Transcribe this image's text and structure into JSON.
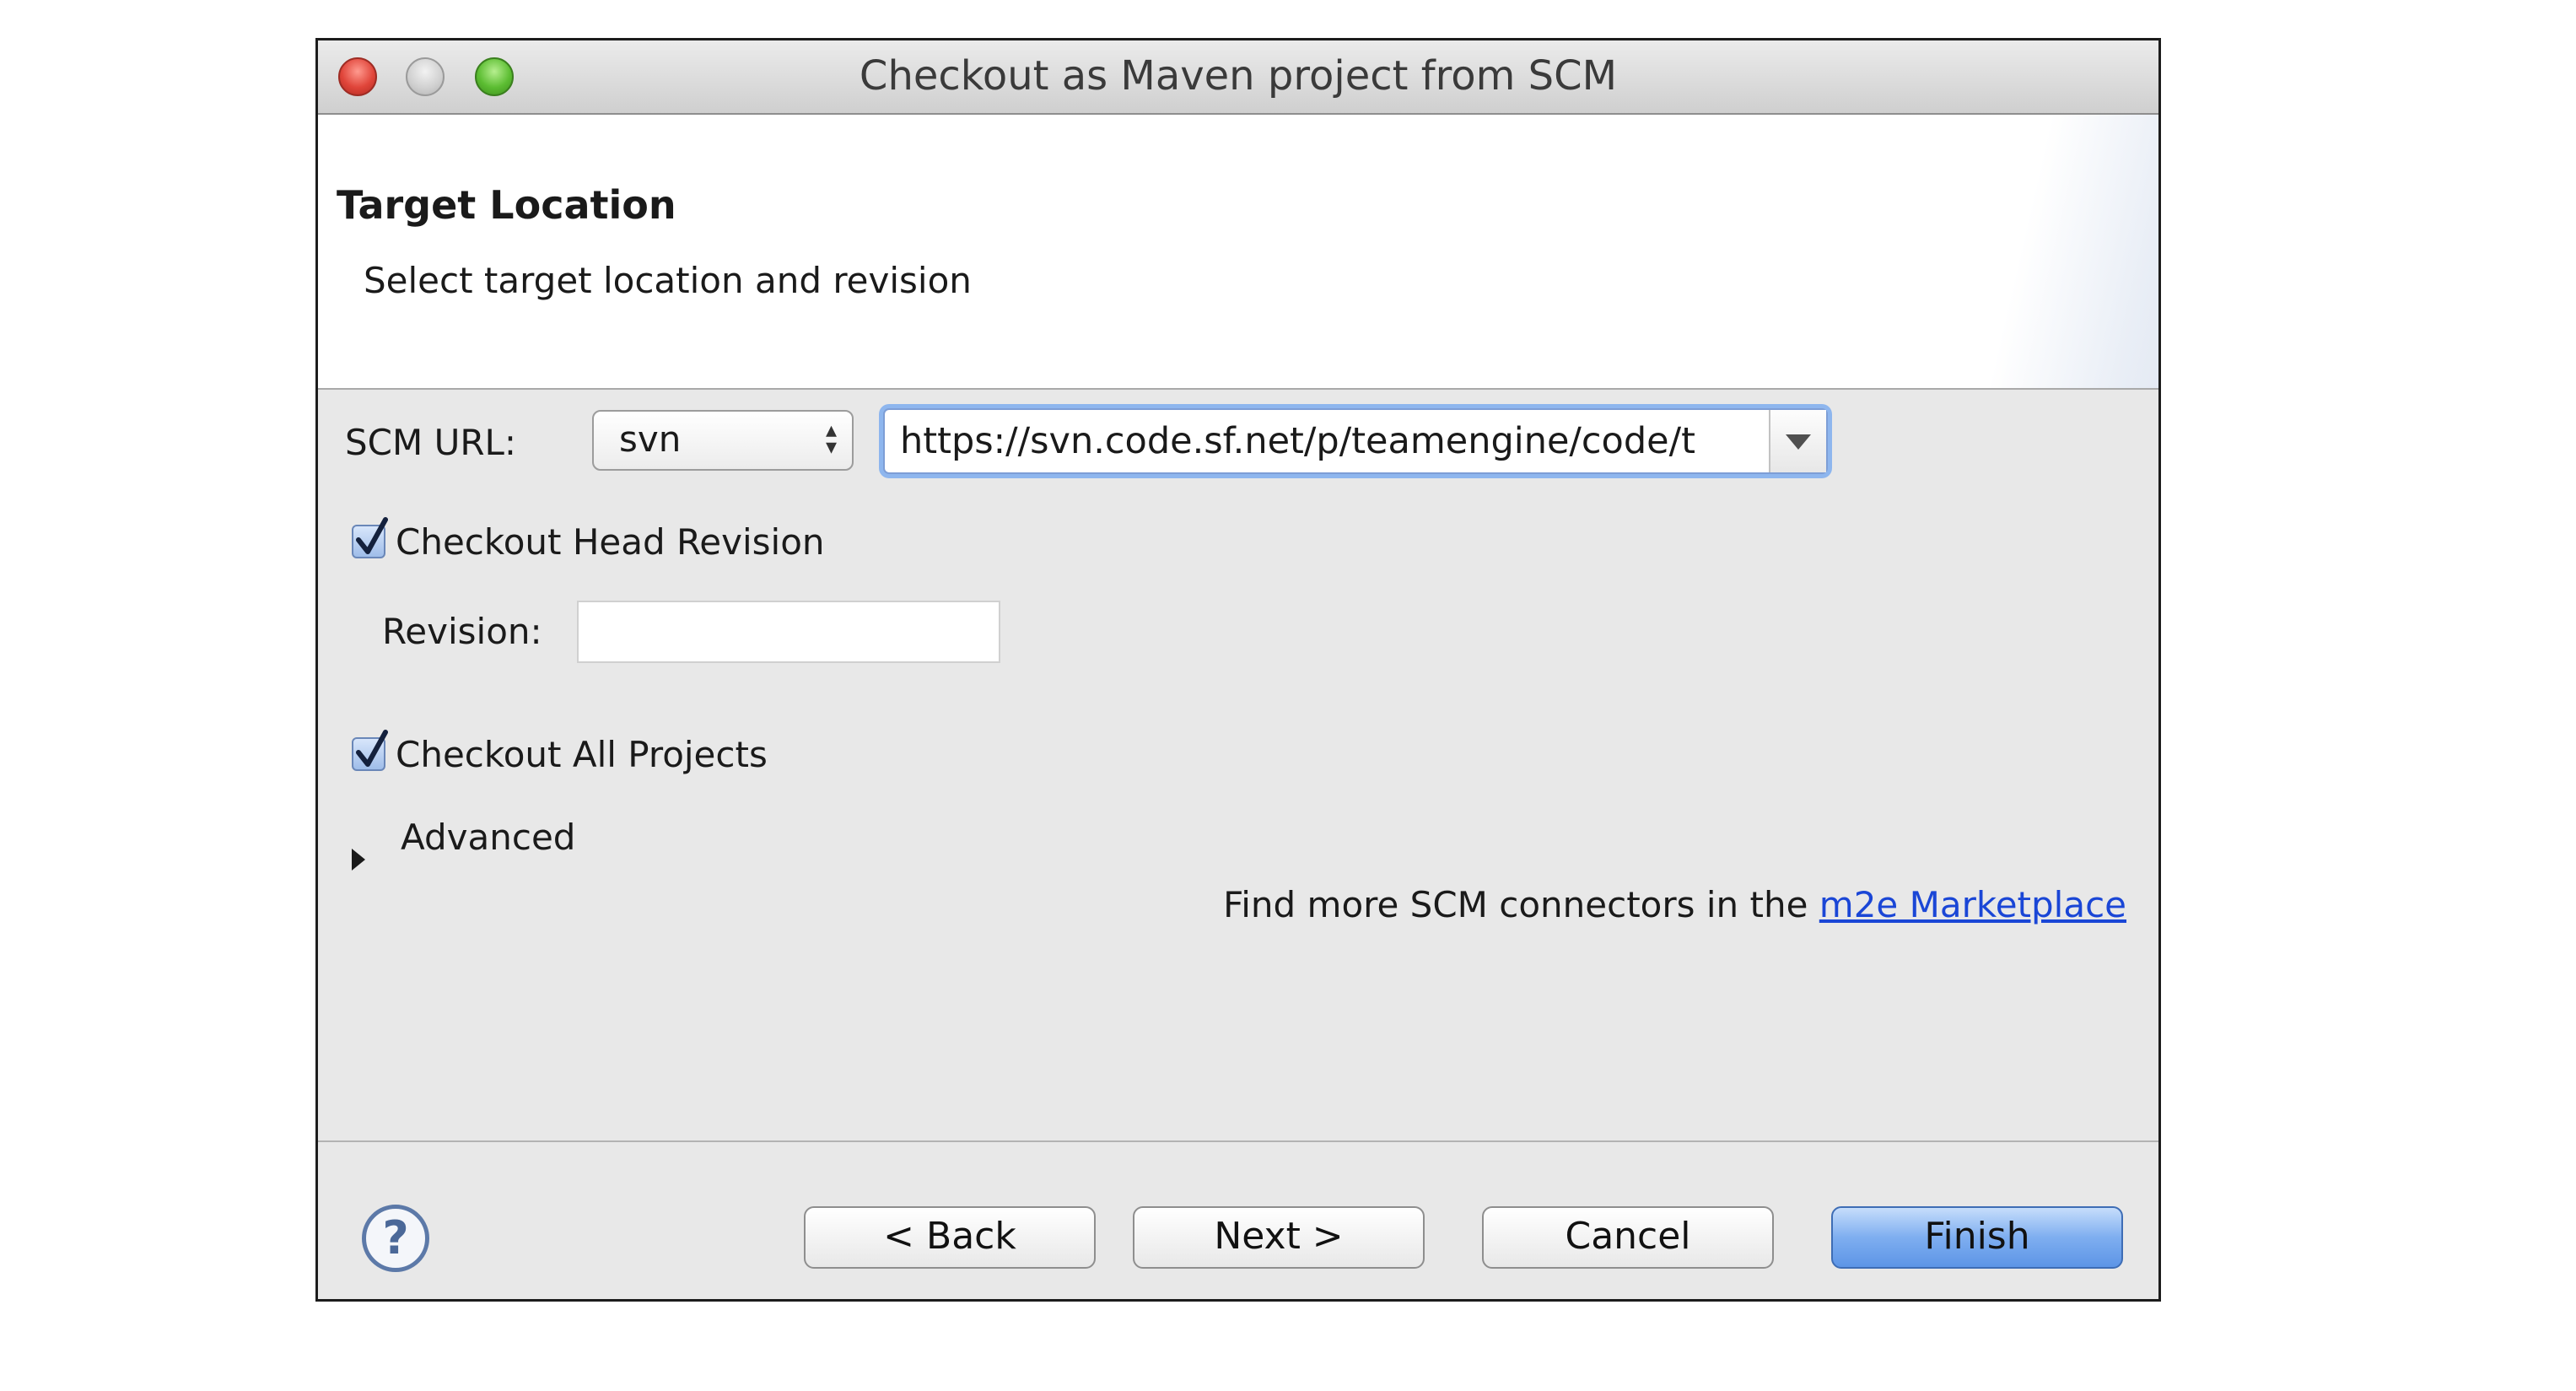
{
  "window": {
    "title": "Checkout as Maven project from SCM"
  },
  "header": {
    "title": "Target Location",
    "description": "Select target location and revision"
  },
  "form": {
    "scm_url_label": "SCM URL:",
    "scm_type": "svn",
    "scm_url": "https://svn.code.sf.net/p/teamengine/code/t",
    "checkout_head_label": "Checkout Head Revision",
    "checkout_head_checked": true,
    "revision_label": "Revision:",
    "revision_value": "",
    "checkout_all_label": "Checkout All Projects",
    "checkout_all_checked": true,
    "advanced_label": "Advanced",
    "marketplace_text": "Find more SCM connectors in the",
    "marketplace_link": "m2e Marketplace"
  },
  "footer": {
    "help_symbol": "?",
    "back_label": "< Back",
    "next_label": "Next >",
    "cancel_label": "Cancel",
    "finish_label": "Finish"
  },
  "colors": {
    "accent": "#5d95e6",
    "link": "#1a46d6"
  }
}
